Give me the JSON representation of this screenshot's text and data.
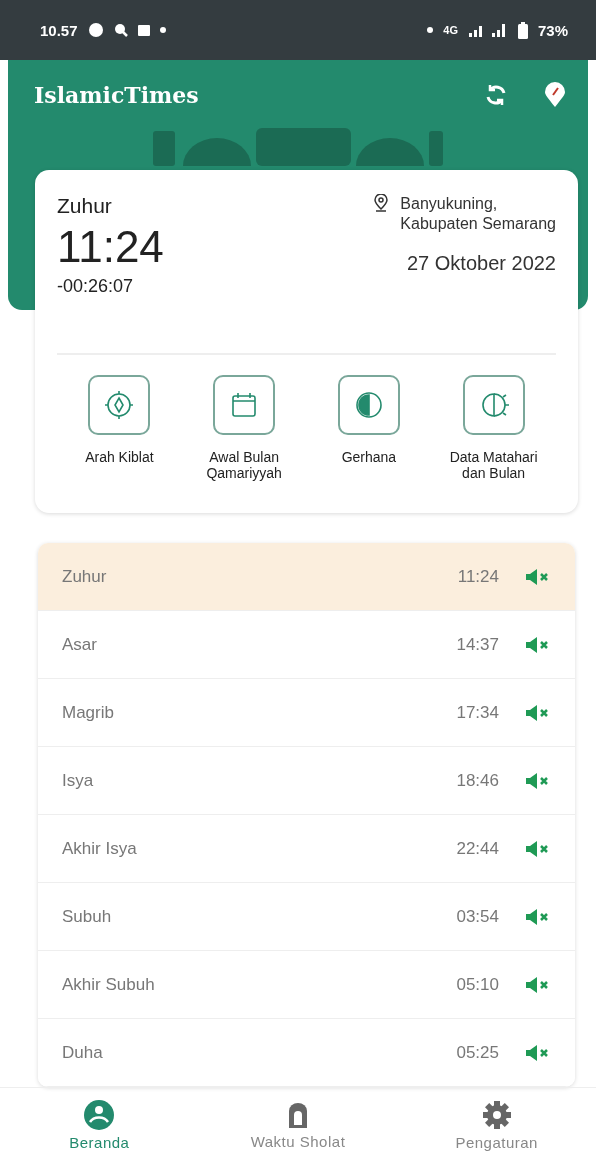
{
  "status_bar": {
    "time": "10.57",
    "network": "4G",
    "battery": "73%"
  },
  "app_bar": {
    "title": "IslamicTimes"
  },
  "current": {
    "prayer": "Zuhur",
    "time": "11:24",
    "countdown": "-00:26:07",
    "location": "Banyukuning,\nKabupaten Semarang",
    "date": "27 Oktober 2022"
  },
  "shortcuts": [
    {
      "kind": "compass",
      "label": "Arah Kiblat"
    },
    {
      "kind": "calendar",
      "label": "Awal Bulan\nQamariyyah"
    },
    {
      "kind": "eclipse",
      "label": "Gerhana"
    },
    {
      "kind": "sunmoon",
      "label": "Data Matahari\ndan Bulan"
    }
  ],
  "prayers": [
    {
      "name": "Zuhur",
      "time": "11:24",
      "selected": true,
      "muted": true
    },
    {
      "name": "Asar",
      "time": "14:37",
      "selected": false,
      "muted": true
    },
    {
      "name": "Magrib",
      "time": "17:34",
      "selected": false,
      "muted": true
    },
    {
      "name": "Isya",
      "time": "18:46",
      "selected": false,
      "muted": true
    },
    {
      "name": "Akhir Isya",
      "time": "22:44",
      "selected": false,
      "muted": true
    },
    {
      "name": "Subuh",
      "time": "03:54",
      "selected": false,
      "muted": true
    },
    {
      "name": "Akhir Subuh",
      "time": "05:10",
      "selected": false,
      "muted": true
    },
    {
      "name": "Duha",
      "time": "05:25",
      "selected": false,
      "muted": true
    }
  ],
  "nav": [
    {
      "kind": "home",
      "label": "Beranda",
      "selected": true
    },
    {
      "kind": "mosque",
      "label": "Waktu Sholat",
      "selected": false
    },
    {
      "kind": "gear",
      "label": "Pengaturan",
      "selected": false
    }
  ]
}
